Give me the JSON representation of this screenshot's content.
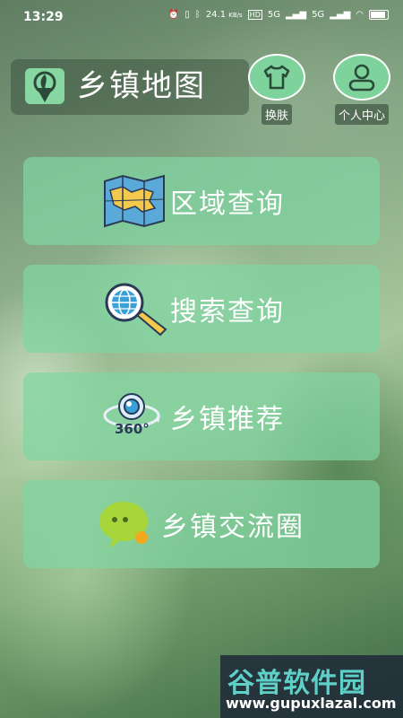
{
  "status": {
    "time": "13:29",
    "speed": "24.1",
    "speed_unit": "KB/s",
    "hd": "HD",
    "net1": "5G",
    "net2": "5G"
  },
  "header": {
    "title": "乡镇地图",
    "skin_label": "换肤",
    "profile_label": "个人中心"
  },
  "menu": {
    "region_query": "区域查询",
    "search_query": "搜索查询",
    "recommend": "乡镇推荐",
    "recommend_badge": "360°",
    "community": "乡镇交流圈"
  },
  "watermark": {
    "brand": "谷普软件园",
    "url": "www.gupuxlazal.com"
  },
  "colors": {
    "accent": "#7dd39b",
    "card": "#80d6a2",
    "watermark_brand": "#5fd0c8"
  }
}
